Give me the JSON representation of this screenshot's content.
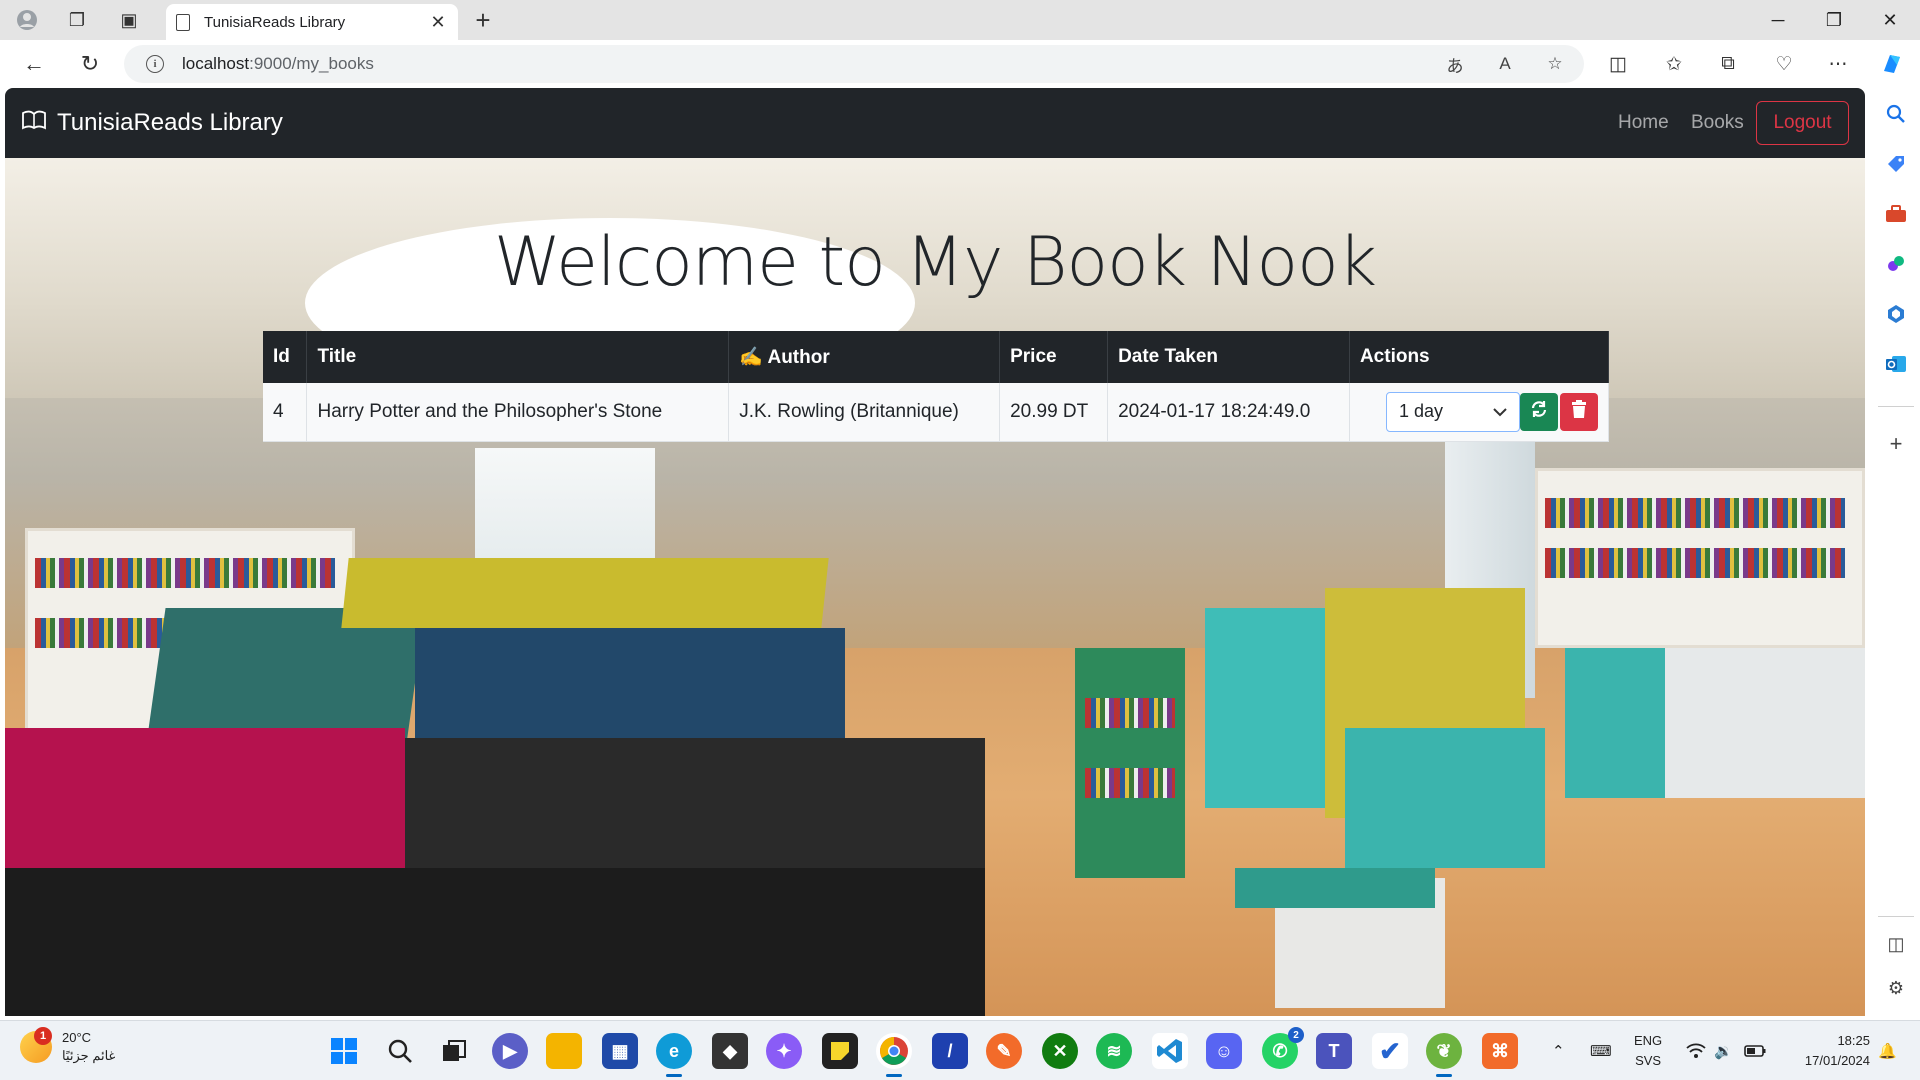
{
  "browser": {
    "tab_title": "TunisiaReads Library",
    "url_host": "localhost",
    "url_path": ":9000/my_books"
  },
  "navbar": {
    "brand": "TunisiaReads Library",
    "links": [
      "Home",
      "Books"
    ],
    "logout_label": "Logout"
  },
  "page": {
    "heading": "Welcome to My Book Nook"
  },
  "table": {
    "headers": [
      "Id",
      "Title",
      "Author",
      "Price",
      "Date Taken",
      "Actions"
    ],
    "author_header_emoji": "✍",
    "rows": [
      {
        "id": "4",
        "title": "Harry Potter and the Philosopher's Stone",
        "author": "J.K. Rowling (Britannique)",
        "price": "20.99 DT",
        "date_taken": "2024-01-17 18:24:49.0",
        "duration": "1 day"
      }
    ]
  },
  "taskbar": {
    "weather_temp": "20°C",
    "weather_desc": "غائم جزئيًا",
    "weather_badge": "1",
    "whatsapp_badge": "2",
    "lang_1": "ENG",
    "lang_2": "SVS",
    "time": "18:25",
    "date": "17/01/2024"
  },
  "colors": {
    "navbar_bg": "#212529",
    "logout": "#dc3545",
    "renew_button": "#198754",
    "delete_button": "#dc3545"
  }
}
